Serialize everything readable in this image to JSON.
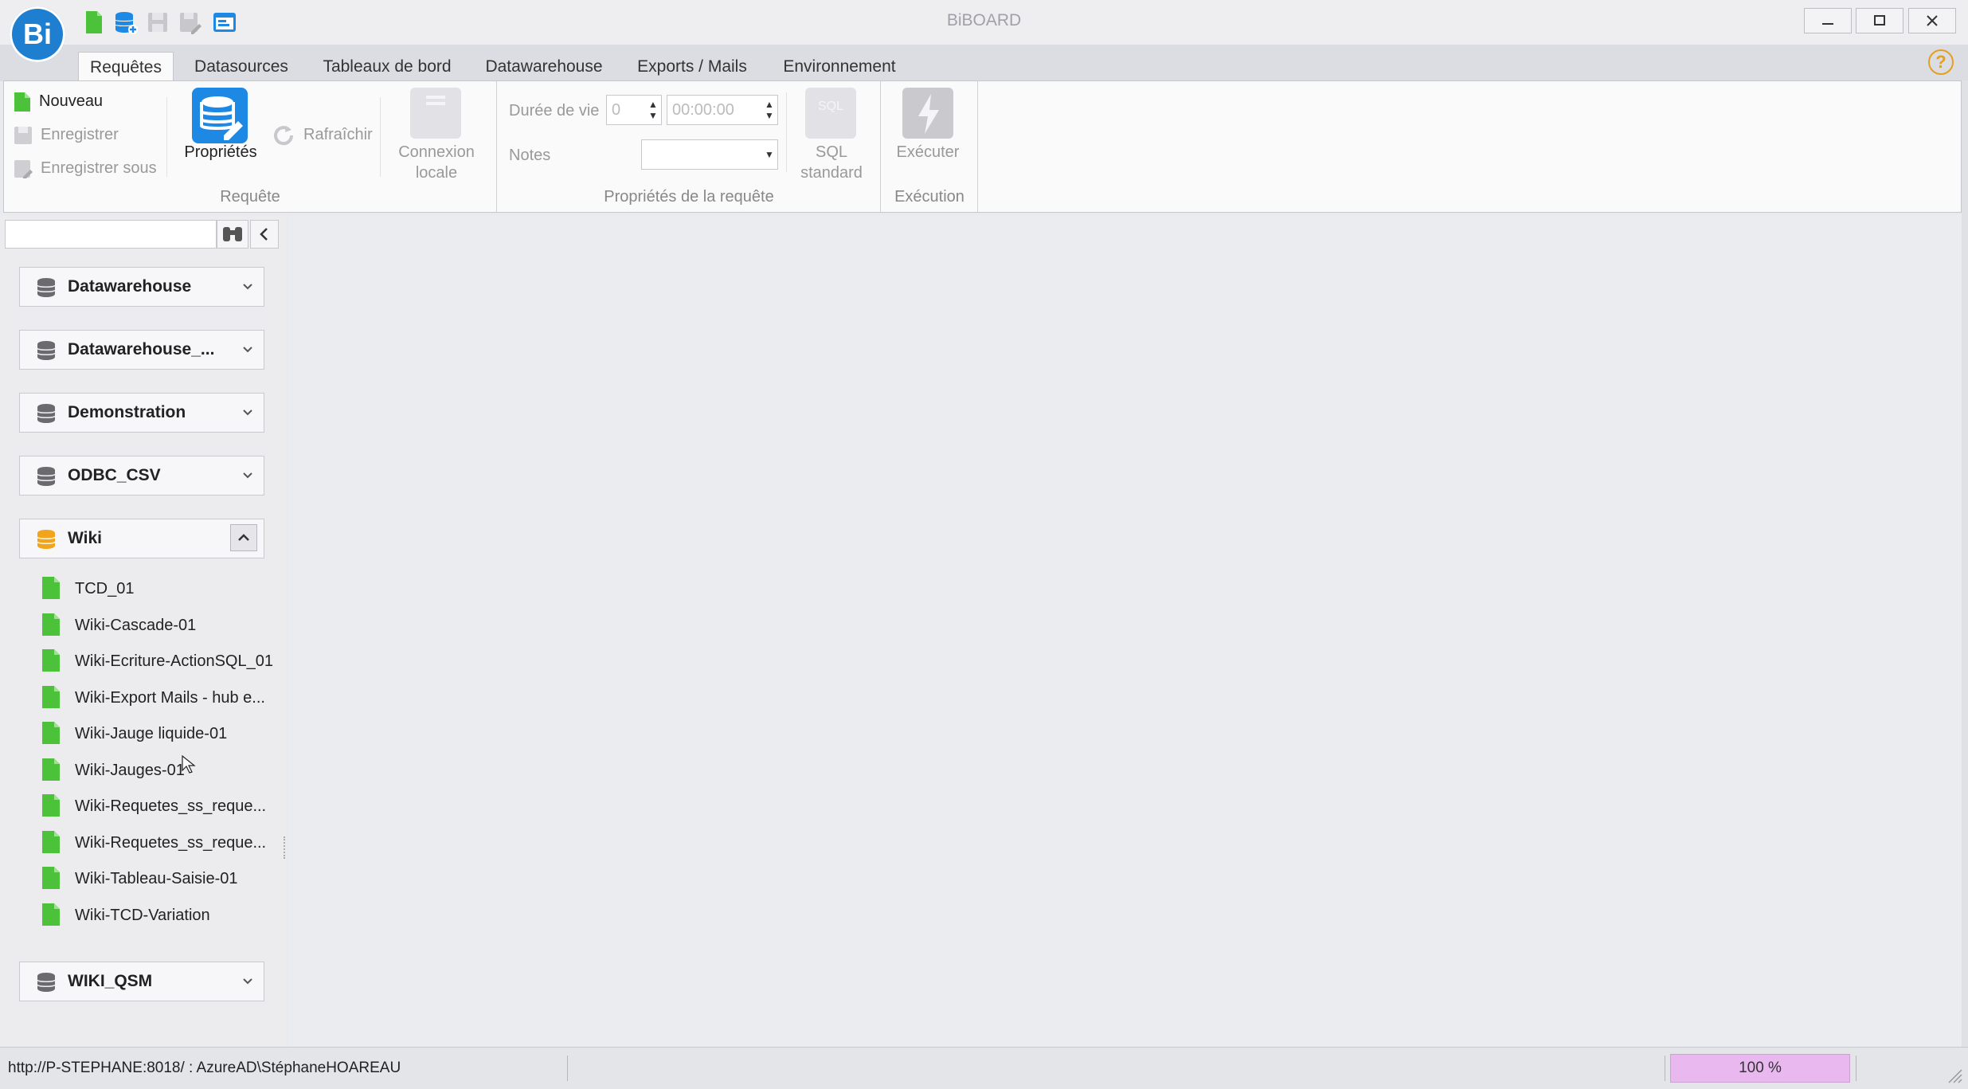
{
  "window": {
    "title": "BiBOARD",
    "logo_text": "Bi"
  },
  "tabs": [
    {
      "label": "Requêtes",
      "active": true
    },
    {
      "label": "Datasources"
    },
    {
      "label": "Tableaux de bord"
    },
    {
      "label": "Datawarehouse"
    },
    {
      "label": "Exports / Mails"
    },
    {
      "label": "Environnement"
    }
  ],
  "ribbon": {
    "requete": {
      "group_label": "Requête",
      "nouveau": "Nouveau",
      "enregistrer": "Enregistrer",
      "enregistrer_sous": "Enregistrer sous",
      "proprietes": "Propriétés",
      "rafraichir": "Rafraîchir",
      "connexion_line1": "Connexion",
      "connexion_line2": "locale"
    },
    "proprietes": {
      "group_label": "Propriétés de la requête",
      "duree_label": "Durée de vie",
      "duree_value": "0",
      "time_value": "00:00:00",
      "notes_label": "Notes",
      "notes_value": "",
      "sql_line1": "SQL",
      "sql_line2": "standard",
      "sql_icon_text": "SQL"
    },
    "execution": {
      "group_label": "Exécution",
      "executer": "Exécuter"
    }
  },
  "search": {
    "placeholder": ""
  },
  "datasources": [
    {
      "name": "Datawarehouse",
      "expanded": false
    },
    {
      "name": "Datawarehouse_...",
      "expanded": false
    },
    {
      "name": "Demonstration",
      "expanded": false
    },
    {
      "name": "ODBC_CSV",
      "expanded": false
    },
    {
      "name": "Wiki",
      "expanded": true
    },
    {
      "name": "WIKI_QSM",
      "expanded": false
    }
  ],
  "wiki_queries": [
    "TCD_01",
    "Wiki-Cascade-01",
    "Wiki-Ecriture-ActionSQL_01",
    "Wiki-Export Mails - hub e...",
    "Wiki-Jauge liquide-01",
    "Wiki-Jauges-01",
    "Wiki-Requetes_ss_reque...",
    "Wiki-Requetes_ss_reque...",
    "Wiki-Tableau-Saisie-01",
    "Wiki-TCD-Variation"
  ],
  "status": {
    "connection": "http://P-STEPHANE:8018/ : AzureAD\\StéphaneHOAREAU",
    "zoom": "100 %"
  },
  "colors": {
    "accent": "#1e88e5",
    "doc_green": "#4cc23a",
    "db_gray": "#6b6b6f",
    "db_orange": "#f2a51c",
    "zoom_bg": "#e8b8ef"
  }
}
